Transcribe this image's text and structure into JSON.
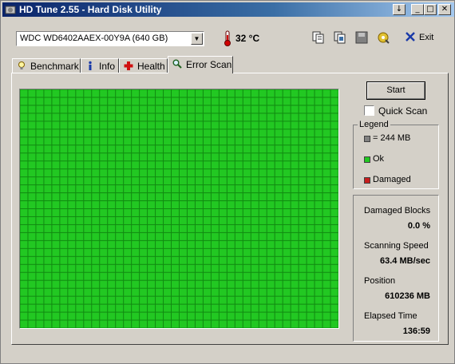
{
  "window": {
    "title": "HD Tune 2.55 - Hard Disk Utility"
  },
  "title_buttons": {
    "help": "↓",
    "minimize": "_",
    "maximize": "□",
    "close": "✕"
  },
  "toolbar": {
    "drive": "WDC WD6402AAEX-00Y9A (640 GB)",
    "temperature": "32 °C",
    "exit_label": "Exit"
  },
  "tabs": [
    {
      "label": "Benchmark",
      "icon": "benchmark-icon"
    },
    {
      "label": "Info",
      "icon": "info-icon"
    },
    {
      "label": "Health",
      "icon": "health-icon"
    },
    {
      "label": "Error Scan",
      "icon": "magnifier-icon",
      "active": true
    }
  ],
  "scan": {
    "start_label": "Start",
    "quick_scan_label": "Quick Scan",
    "quick_scan_checked": false,
    "grid_cols": 40,
    "grid_rows": 30,
    "block_status": "ok"
  },
  "legend": {
    "title": "Legend",
    "items": [
      {
        "label": "= 244 MB",
        "color": "#808080"
      },
      {
        "label": "Ok",
        "color": "#22c822"
      },
      {
        "label": "Damaged",
        "color": "#c81e1e"
      }
    ]
  },
  "stats": {
    "damaged_blocks_label": "Damaged Blocks",
    "damaged_blocks_value": "0.0 %",
    "scanning_speed_label": "Scanning Speed",
    "scanning_speed_value": "63.4 MB/sec",
    "position_label": "Position",
    "position_value": "610236 MB",
    "elapsed_label": "Elapsed Time",
    "elapsed_value": "136:59"
  },
  "colors": {
    "ok_block": "#22c822",
    "grid_line": "#118a11",
    "titlebar": "#0a246a"
  }
}
